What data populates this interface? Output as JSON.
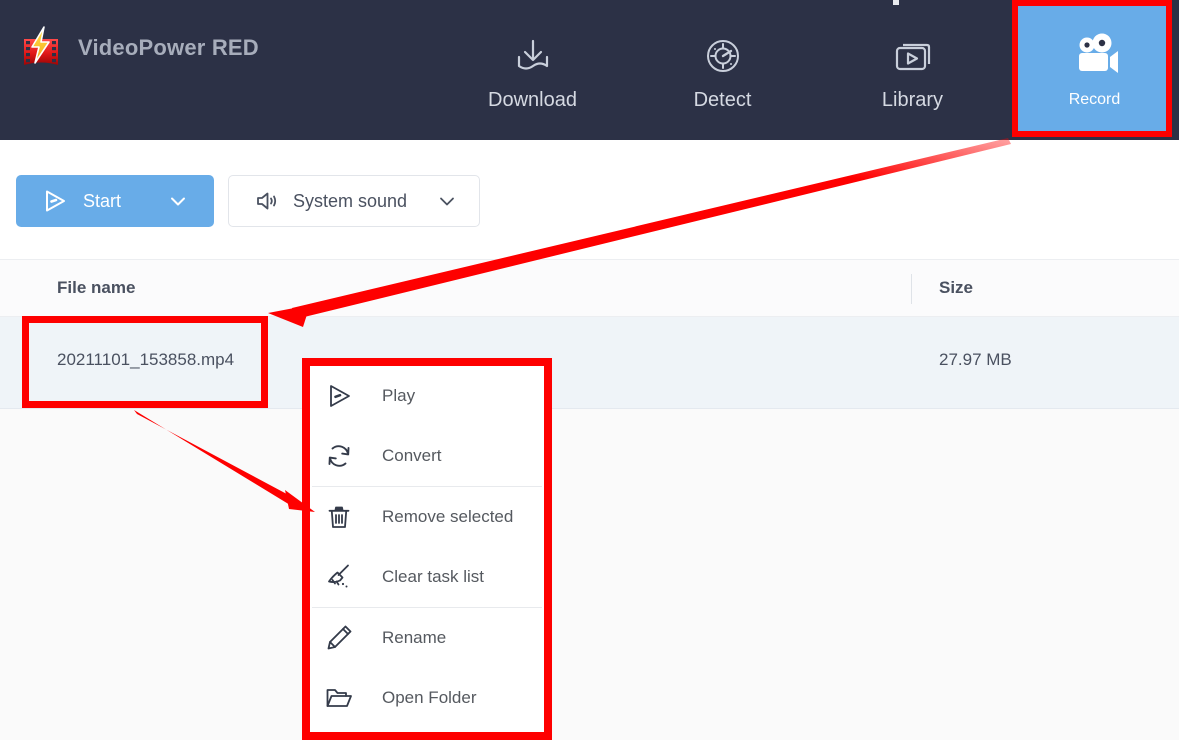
{
  "app": {
    "title": "VideoPower RED",
    "logo_icon": "film-lightning-logo",
    "accent_blue": "#68ace8",
    "header_bg": "#2c3146",
    "annotation_red": "#fe0000",
    "row_highlight": "#eff4f8"
  },
  "nav": {
    "tabs": [
      {
        "label": "Download",
        "icon": "download-tray-icon",
        "active": false
      },
      {
        "label": "Detect",
        "icon": "radar-detect-icon",
        "active": false
      },
      {
        "label": "Library",
        "icon": "video-library-icon",
        "active": false
      },
      {
        "label": "Record",
        "icon": "video-camera-icon",
        "active": true
      }
    ]
  },
  "toolbar": {
    "start": {
      "label": "Start",
      "icon": "play-triangle-icon",
      "caret": "chevron-down-icon"
    },
    "sound": {
      "label": "System sound",
      "icon": "speaker-sound-icon",
      "caret": "chevron-down-icon"
    }
  },
  "table": {
    "columns": {
      "file_name": "File name",
      "size": "Size"
    },
    "rows": [
      {
        "file_name": "20211101_153858.mp4",
        "size": "27.97 MB",
        "selected": true
      }
    ]
  },
  "context_menu": {
    "items": [
      {
        "label": "Play",
        "icon": "play-triangle-icon",
        "separator_after": false
      },
      {
        "label": "Convert",
        "icon": "convert-refresh-icon",
        "separator_after": true
      },
      {
        "label": "Remove selected",
        "icon": "trash-bin-icon",
        "separator_after": false
      },
      {
        "label": "Clear task list",
        "icon": "broom-icon",
        "separator_after": true
      },
      {
        "label": "Rename",
        "icon": "pencil-icon",
        "separator_after": false
      },
      {
        "label": "Open Folder",
        "icon": "folder-open-icon",
        "separator_after": false
      }
    ]
  },
  "annotations": {
    "boxes": [
      {
        "name": "record-tab-highlight"
      },
      {
        "name": "file-name-highlight"
      },
      {
        "name": "context-menu-highlight"
      }
    ],
    "arrows": [
      {
        "name": "record-to-file-arrow",
        "from": "Record tab",
        "to": "file name cell"
      },
      {
        "name": "file-to-remove-arrow",
        "from": "file name cell",
        "to": "Remove selected menu item"
      }
    ]
  }
}
